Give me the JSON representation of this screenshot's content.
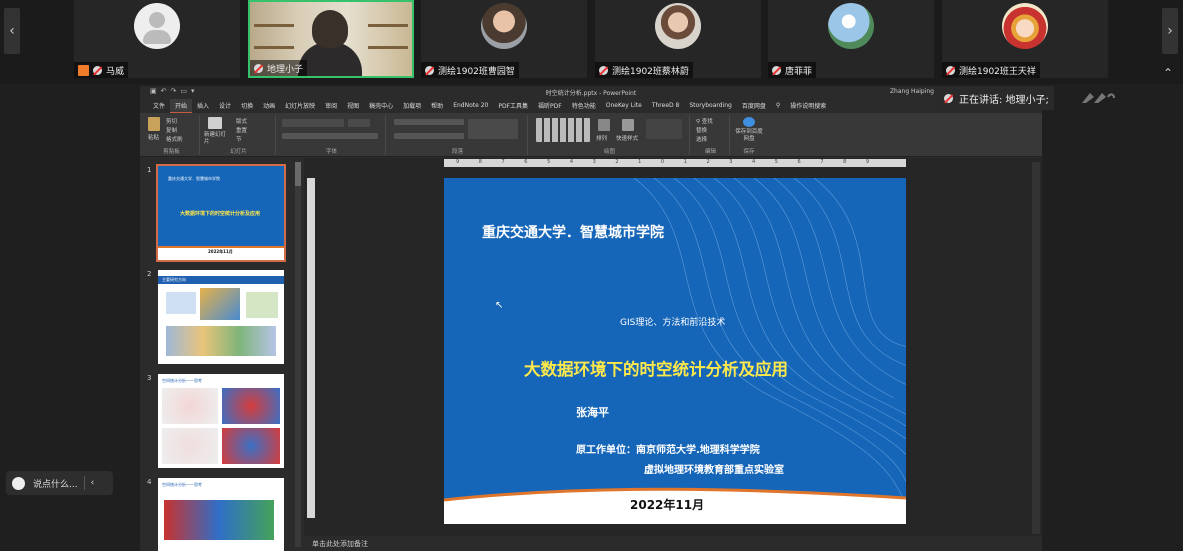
{
  "participants": [
    {
      "name": "马威",
      "avatar": "default-avatar"
    },
    {
      "name": "地理小子",
      "avatar": "camera-video",
      "active": true
    },
    {
      "name": "测绘1902班曹园智",
      "avatar": "photo"
    },
    {
      "name": "测绘1902班蔡林蔚",
      "avatar": "photo"
    },
    {
      "name": "唐菲菲",
      "avatar": "photo"
    },
    {
      "name": "测绘1902班王天祥",
      "avatar": "anime-photo"
    }
  ],
  "speaking": {
    "label": "正在讲话: 地理小子;"
  },
  "chat": {
    "placeholder": "说点什么..."
  },
  "ppt": {
    "window_title": "时空统计分析.pptx - PowerPoint",
    "user": "Zhang Haiping",
    "menu": [
      "文件",
      "开始",
      "插入",
      "设计",
      "切换",
      "动画",
      "幻灯片放映",
      "审阅",
      "视图",
      "稿壳中心",
      "加载项",
      "帮助",
      "EndNote 20",
      "PDF工具集",
      "福昕PDF",
      "特色功能",
      "OneKey Lite",
      "ThreeD 8",
      "Storyboarding",
      "百度网盘",
      "操作说明搜索"
    ],
    "active_menu": "开始",
    "ribbon": {
      "clipboard": {
        "paste": "粘贴",
        "cut": "剪切",
        "copy": "复制",
        "format_painter": "格式刷",
        "label": "剪贴板"
      },
      "slides": {
        "new_slide": "新建幻灯片",
        "layout": "版式",
        "reset": "重置",
        "section": "节",
        "label": "幻灯片"
      },
      "font": {
        "label": "字体"
      },
      "paragraph": {
        "label": "段落"
      },
      "drawing": {
        "arrange": "排列",
        "quick_styles": "快速样式",
        "label": "绘图"
      },
      "editing": {
        "find": "查找",
        "replace": "替换",
        "select": "选择",
        "label": "编辑"
      },
      "save": {
        "save_baidu": "保存到百度网盘",
        "label": "保存"
      }
    },
    "status_notes": "单击此处添加备注",
    "ruler_h": "9 8 7 6 5 4 3 2 1 0 1 2 3 4 5 6 7 8 9",
    "thumbnails": [
      {
        "num": "1",
        "title": "重庆交通大学．智慧城市学院",
        "main": "大数据环境下的时空统计分析及应用",
        "date": "2022年11月",
        "selected": true
      },
      {
        "num": "2",
        "title": "主要研究方向"
      },
      {
        "num": "3",
        "title": "空间统计分析——思考"
      },
      {
        "num": "4",
        "title": "空间统计分析——思考"
      }
    ],
    "slide": {
      "school": "重庆交通大学．智慧城市学院",
      "subtitle": "GIS理论、方法和前沿技术",
      "title": "大数据环境下的时空统计分析及应用",
      "author": "张海平",
      "org1": "原工作单位：南京师范大学.地理科学学院",
      "org2": "虚拟地理环境教育部重点实验室",
      "date": "2022年11月"
    }
  }
}
